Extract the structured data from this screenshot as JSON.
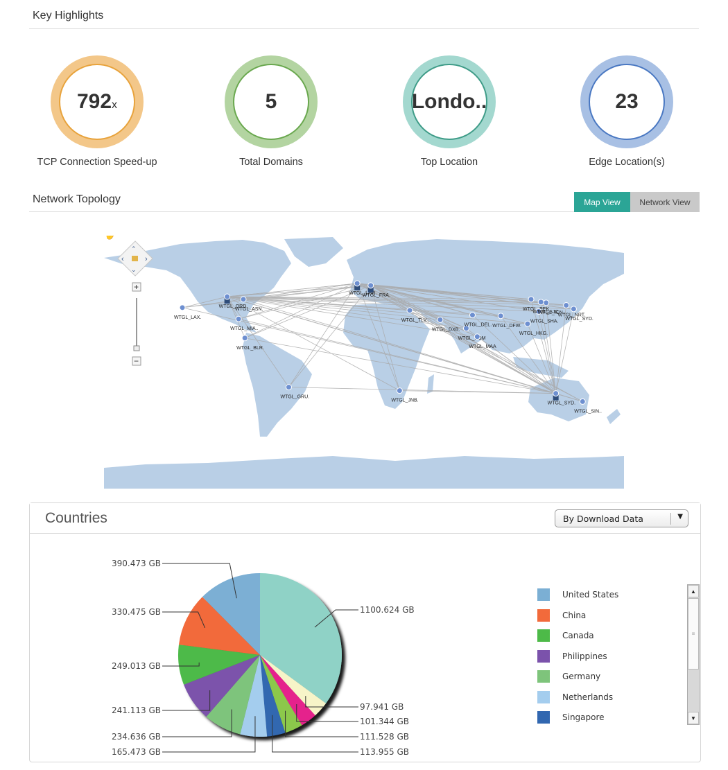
{
  "highlights": {
    "title": "Key Highlights",
    "kpis": [
      {
        "value": "792",
        "unit": "x",
        "label": "TCP Connection Speed-up",
        "outer_color": "#f3c789",
        "inner_color": "#e8a33c"
      },
      {
        "value": "5",
        "unit": "",
        "label": "Total Domains",
        "outer_color": "#b3d4a1",
        "inner_color": "#6aa84f"
      },
      {
        "value": "Londo..",
        "unit": "",
        "label": "Top Location",
        "outer_color": "#a3d8cf",
        "inner_color": "#3f9c88"
      },
      {
        "value": "23",
        "unit": "",
        "label": "Edge Location(s)",
        "outer_color": "#a8c0e4",
        "inner_color": "#4a78c2"
      }
    ]
  },
  "topology": {
    "title": "Network Topology",
    "view_toggle": {
      "map_view": "Map View",
      "network_view": "Network View",
      "active": "Map View",
      "active_color": "#2ba596"
    },
    "map_controls": {
      "pan_icon": "hand-icon",
      "zoom_in": "+",
      "zoom_out": "−"
    },
    "nodes": [
      {
        "id": "lax",
        "label": "WTGL_LAX.",
        "lon": -118,
        "lat": 34
      },
      {
        "id": "ord",
        "label": "WTGL_ORD",
        "lon": -87.9,
        "lat": 41.9,
        "hub": true
      },
      {
        "id": "asn",
        "label": "WTGL_ASN.",
        "lon": -77,
        "lat": 40
      },
      {
        "id": "mia",
        "label": "WTGL_MIA..",
        "lon": -80.2,
        "lat": 25.8
      },
      {
        "id": "blr",
        "label": "WTGL_BLR.",
        "lon": -76,
        "lat": 12
      },
      {
        "id": "gru",
        "label": "WTGL_GRU.",
        "lon": -46.5,
        "lat": -23.5
      },
      {
        "id": "lhr",
        "label": "WTGL_LHR.",
        "lon": -0.5,
        "lat": 51.5,
        "hub": true
      },
      {
        "id": "fra",
        "label": "WTGL_FRA.",
        "lon": 8.6,
        "lat": 50,
        "hub": true
      },
      {
        "id": "tlv",
        "label": "WTGL_TLV..",
        "lon": 34.8,
        "lat": 32
      },
      {
        "id": "dxb",
        "label": "WTGL_DXB.",
        "lon": 55.3,
        "lat": 25.2
      },
      {
        "id": "bom",
        "label": "WTGL_BOM",
        "lon": 72.8,
        "lat": 19
      },
      {
        "id": "del",
        "label": "WTGL_DEL.",
        "lon": 77,
        "lat": 28.6
      },
      {
        "id": "maa",
        "label": "WTGL_MAA",
        "lon": 80.2,
        "lat": 13
      },
      {
        "id": "dfw",
        "label": "WTGL_DFW.",
        "lon": 96,
        "lat": 28
      },
      {
        "id": "pek",
        "label": "WTGL_PEK",
        "lon": 116.4,
        "lat": 40
      },
      {
        "id": "hkg",
        "label": "WTGL_HKG.",
        "lon": 114,
        "lat": 22.3
      },
      {
        "id": "sha",
        "label": "WTGL_SHA.",
        "lon": 121.5,
        "lat": 31.2
      },
      {
        "id": "icn",
        "label": "WTGL_ICN..",
        "lon": 126.5,
        "lat": 37.5
      },
      {
        "id": "sjc",
        "label": "WTGL_SJC.",
        "lon": 123,
        "lat": 38
      },
      {
        "id": "nrt",
        "label": "WTGL_NRT.",
        "lon": 140,
        "lat": 35.7
      },
      {
        "id": "syd2",
        "label": "WTGL_SYD.",
        "lon": 145,
        "lat": 33
      },
      {
        "id": "syd",
        "label": "WTGL_SYD.",
        "lon": 133,
        "lat": -28,
        "hub": true
      },
      {
        "id": "sin",
        "label": "WTGL_SIN..",
        "lon": 151,
        "lat": -33.9
      },
      {
        "id": "jnb",
        "label": "WTGL_JNB.",
        "lon": 28,
        "lat": -26
      }
    ]
  },
  "countries": {
    "title": "Countries",
    "dropdown": {
      "selected": "By Download Data"
    },
    "legend": [
      {
        "name": "United States",
        "color": "#7bafd4"
      },
      {
        "name": "China",
        "color": "#f26a3b"
      },
      {
        "name": "Canada",
        "color": "#4dba48"
      },
      {
        "name": "Philippines",
        "color": "#7b52ab"
      },
      {
        "name": "Germany",
        "color": "#7ec47b"
      },
      {
        "name": "Netherlands",
        "color": "#a4cdee"
      },
      {
        "name": "Singapore",
        "color": "#3167b0"
      }
    ]
  },
  "chart_data": {
    "type": "pie",
    "title": "Countries",
    "unit": "GB",
    "slices": [
      {
        "name": "",
        "value": 1100.624,
        "label": "1100.624 GB",
        "color": "#8fd2c6"
      },
      {
        "name": "",
        "value": 97.941,
        "label": "97.941 GB",
        "color": "#f7f4c8"
      },
      {
        "name": "",
        "value": 101.344,
        "label": "101.344 GB",
        "color": "#e5228c"
      },
      {
        "name": "",
        "value": 111.528,
        "label": "111.528 GB",
        "color": "#8cc84b"
      },
      {
        "name": "Singapore",
        "value": 113.955,
        "label": "113.955 GB",
        "color": "#3167b0"
      },
      {
        "name": "Netherlands",
        "value": 165.473,
        "label": "165.473 GB",
        "color": "#a4cdee"
      },
      {
        "name": "Germany",
        "value": 234.636,
        "label": "234.636 GB",
        "color": "#7ec47b"
      },
      {
        "name": "Philippines",
        "value": 241.113,
        "label": "241.113 GB",
        "color": "#7b52ab"
      },
      {
        "name": "Canada",
        "value": 249.013,
        "label": "249.013 GB",
        "color": "#4dba48"
      },
      {
        "name": "China",
        "value": 330.475,
        "label": "330.475 GB",
        "color": "#f26a3b"
      },
      {
        "name": "United States",
        "value": 390.473,
        "label": "390.473 GB",
        "color": "#7bafd4"
      }
    ],
    "legend_position": "right"
  }
}
